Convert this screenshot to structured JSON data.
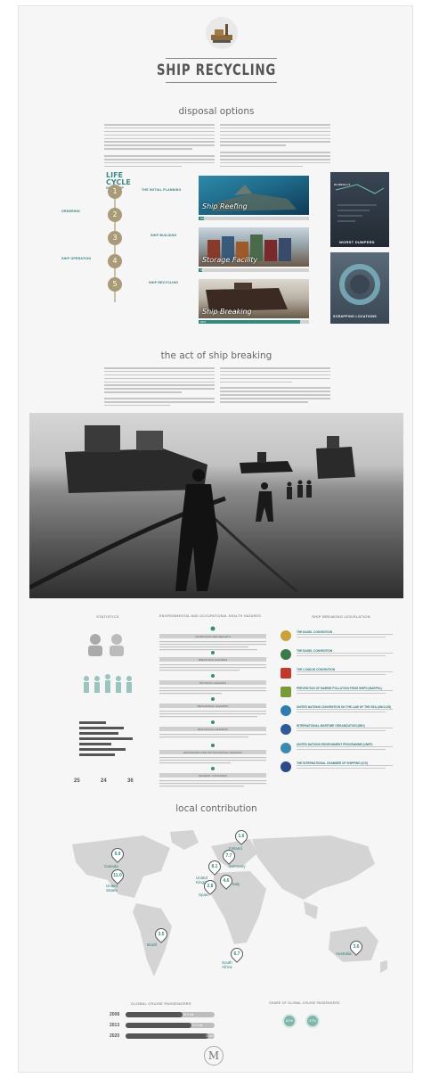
{
  "header": {
    "title": "SHIP RECYCLING",
    "logo_icon": "ship-scrap-logo"
  },
  "disposal": {
    "title": "disposal options",
    "life_cycle": {
      "title_lines": [
        "LIFE",
        "CYCLE",
        "OF A SHIP"
      ],
      "steps": [
        {
          "num": "1",
          "label": "THE INITIAL PLANNING"
        },
        {
          "num": "2",
          "label": "ORDERING"
        },
        {
          "num": "3",
          "label": "SHIP BUILDING"
        },
        {
          "num": "4",
          "label": "SHIP OPERATION"
        },
        {
          "num": "5",
          "label": "SHIP RECYCLING"
        }
      ]
    },
    "options": [
      {
        "caption": "Ship Reefing",
        "percent": "5%",
        "fill": 0.05
      },
      {
        "caption": "Storage Facility",
        "percent": "3%",
        "fill": 0.03
      },
      {
        "caption": "Ship Breaking",
        "percent": "92%",
        "fill": 0.92
      }
    ],
    "panels": {
      "worst": "WORST DUMPERS",
      "scrapping": "SCRAPPING LOCATIONS",
      "globally": "GLOBALLY"
    }
  },
  "breaking": {
    "title": "the act of ship breaking"
  },
  "info": {
    "statistics": "STATISTICS",
    "environmental": "ENVIRONMENTAL AND OCCUPATIONAL HEALTH HAZARDS",
    "legislation": "SHIP BREAKING LEGISLATION",
    "stats_numbers": [
      {
        "value": "25"
      },
      {
        "value": "24"
      },
      {
        "value": "36"
      }
    ],
    "hazards": [
      "SCAFFOLDS AND HEIGHTS",
      "BREATHING HAZARDS",
      "PHYSICAL HAZARDS",
      "MECHANICAL HAZARDS",
      "BIOLOGICAL HAZARDS",
      "ERGONOMIC AND PSYCHOSOCIAL HAZARDS",
      "GENERAL CONCERNS"
    ],
    "legislation_items": [
      {
        "title": "THE BASEL CONVENTION",
        "color": "#c9a23a"
      },
      {
        "title": "THE BASEL CONVENTION",
        "color": "#3a7a4a"
      },
      {
        "title": "THE LONDON CONVENTION",
        "color": "#c0392b"
      },
      {
        "title": "PREVENTION OF MARINE POLLUTION FROM SHIPS (MARPOL)",
        "color": "#7a9a3a"
      },
      {
        "title": "UNITED NATIONS CONVENTION ON THE LAW OF THE SEA (UNCLOS)",
        "color": "#2f7cb0"
      },
      {
        "title": "INTERNATIONAL MARITIME ORGANIZATION (IMO)",
        "color": "#2f5a9a"
      },
      {
        "title": "UNITED NATIONS ENVIRONMENT PROGRAMME (UNEP)",
        "color": "#3a8ab0"
      },
      {
        "title": "THE INTERNATIONAL CHAMBER OF SHIPPING (ICS)",
        "color": "#2a4a8a"
      }
    ]
  },
  "local": {
    "title": "local contribution",
    "pins": [
      {
        "value": "1.6",
        "label": "Finland"
      },
      {
        "value": "9.9",
        "label": "Canada"
      },
      {
        "value": "8.1",
        "label": "United Kingdom"
      },
      {
        "value": "7.7",
        "label": "Germany"
      },
      {
        "value": "11.0",
        "label": "United States"
      },
      {
        "value": "4.6",
        "label": "Italy"
      },
      {
        "value": "2.8",
        "label": "Spain"
      },
      {
        "value": "3.5",
        "label": "Brazil"
      },
      {
        "value": "6.7",
        "label": "South Africa"
      },
      {
        "value": "3.6",
        "label": "Australia"
      }
    ]
  },
  "cargo": {
    "left_title": "GLOBAL CRUISE PASSENGERS",
    "right_title": "SHARE OF GLOBAL CRUISE PASSENGERS",
    "rows": [
      {
        "year": "2008",
        "value": "16.3 mil",
        "fill": 0.64
      },
      {
        "year": "2013",
        "value": "21.3 mil",
        "fill": 0.74
      },
      {
        "year": "2020",
        "value": "30.6 mil",
        "fill": 0.93
      }
    ],
    "share": [
      {
        "value": "62%"
      },
      {
        "value": "37%"
      }
    ]
  },
  "footer": {
    "logo_letter": "M"
  }
}
